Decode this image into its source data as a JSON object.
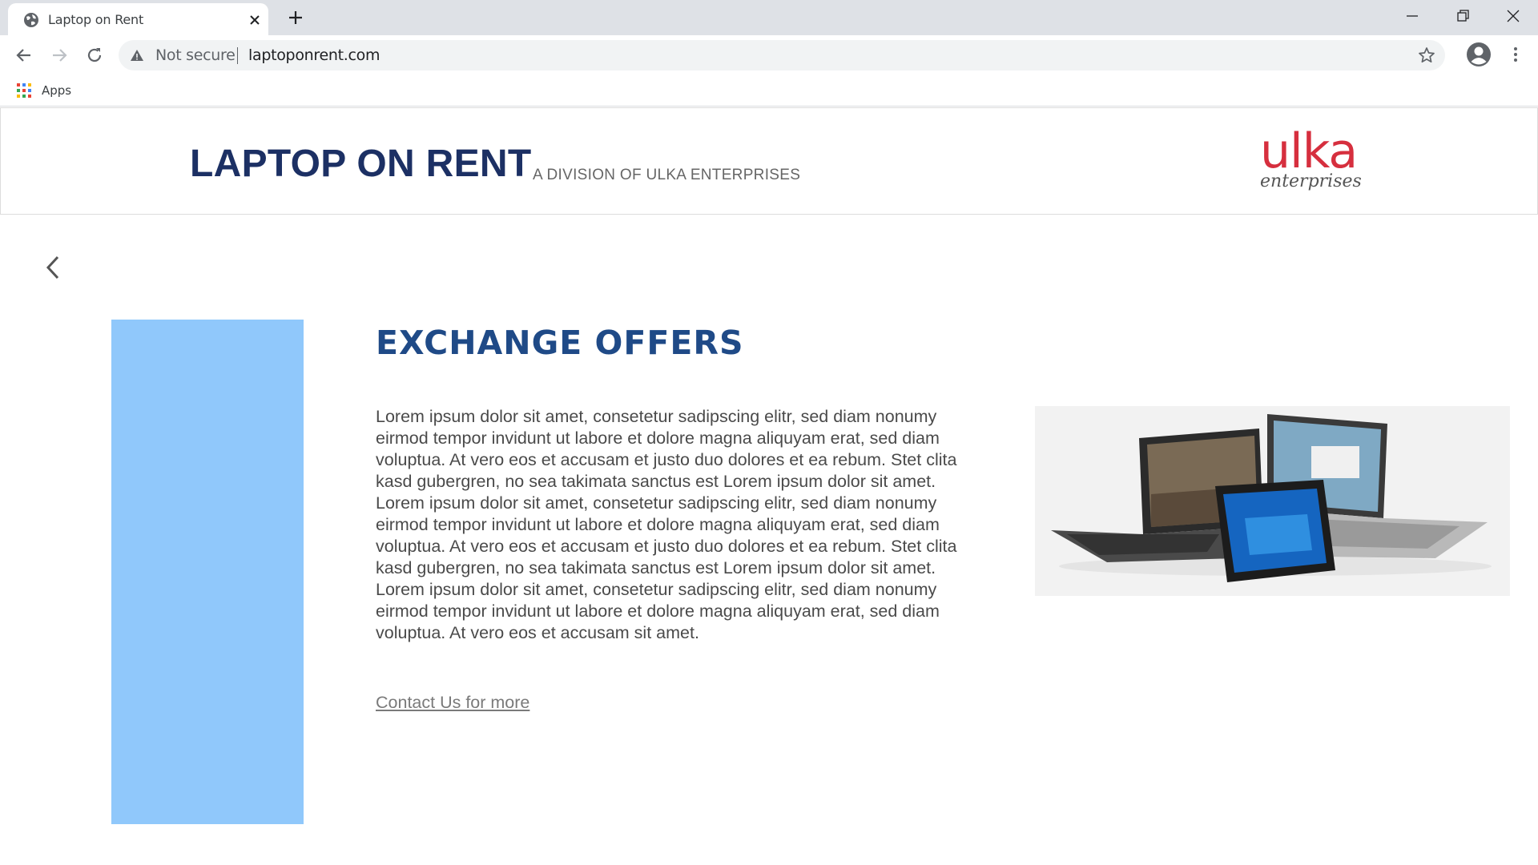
{
  "browser": {
    "tab_title": "Laptop on Rent",
    "security_label": "Not secure",
    "url": "laptoponrent.com",
    "bookmarks": [
      {
        "label": "Apps"
      }
    ]
  },
  "header": {
    "title": "LAPTOP ON RENT",
    "subtitle": "A DIVISION OF ULKA ENTERPRISES",
    "logo_word": "ulka",
    "logo_sub": "enterprises"
  },
  "main": {
    "heading": "EXCHANGE OFFERS",
    "body": "Lorem ipsum dolor sit amet, consetetur sadipscing elitr, sed diam nonumy eirmod tempor invidunt ut labore et dolore magna aliquyam erat, sed diam voluptua. At vero eos et accusam et justo duo dolores et ea rebum. Stet clita kasd gubergren, no sea takimata sanctus est Lorem ipsum dolor sit amet. Lorem ipsum dolor sit amet, consetetur sadipscing elitr, sed diam nonumy eirmod tempor invidunt ut labore et dolore magna aliquyam erat, sed diam voluptua. At vero eos et accusam et justo duo dolores et ea rebum. Stet clita kasd gubergren, no sea takimata sanctus est Lorem ipsum dolor sit amet. Lorem ipsum dolor sit amet, consetetur sadipscing elitr, sed diam nonumy eirmod tempor invidunt ut labore et dolore magna aliquyam erat, sed diam voluptua. At vero eos et accusam sit amet.",
    "contact_link": "Contact Us for more"
  },
  "colors": {
    "title_navy": "#1c3064",
    "heading_blue": "#1f4a87",
    "panel_blue": "#90c8fb",
    "logo_red": "#d62f3e"
  },
  "icons": [
    "globe-icon",
    "close-icon",
    "plus-icon",
    "minimize-icon",
    "restore-icon",
    "window-close-icon",
    "back-icon",
    "forward-icon",
    "reload-icon",
    "warning-icon",
    "star-icon",
    "profile-icon",
    "menu-icon",
    "apps-grid-icon",
    "chevron-left-icon"
  ]
}
